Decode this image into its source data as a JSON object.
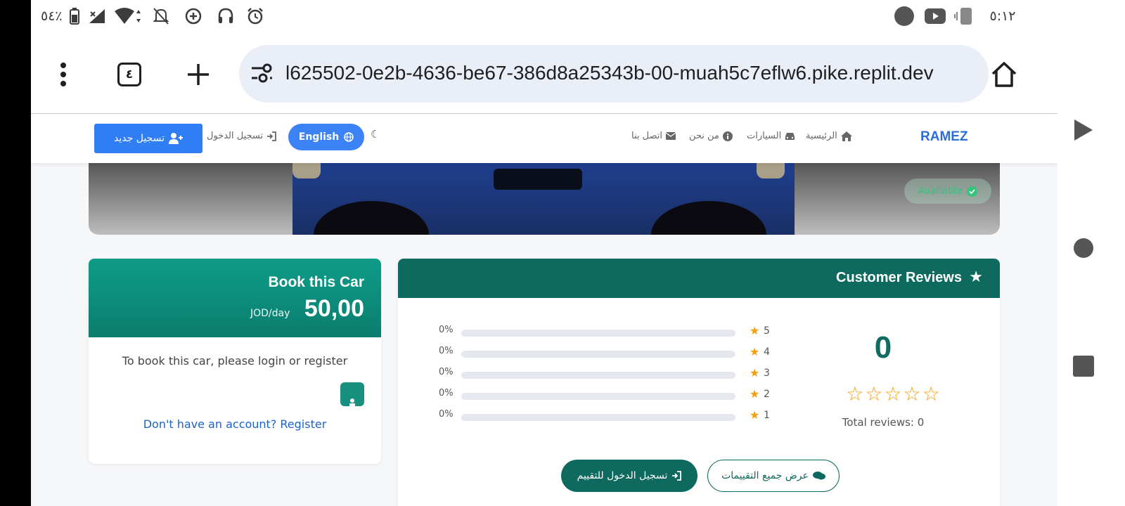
{
  "status_bar": {
    "time": "٥:١٢",
    "battery": "٥٤٪"
  },
  "browser": {
    "url": "l625502-0e2b-4636-be67-386d8a25343b-00-muah5c7eflw6.pike.replit.dev",
    "tab_count": "٤"
  },
  "site_nav": {
    "brand": "RAMEZ",
    "home": "الرئيسية",
    "cars": "السيارات",
    "about": "من نحن",
    "contact": "اتصل بنا",
    "language": "English",
    "login": "تسجيل الدخول",
    "register": "تسجيل جديد"
  },
  "hero": {
    "status": "Available"
  },
  "booking": {
    "title": "Book this Car",
    "price": "50,00",
    "unit": "JOD/day",
    "message": "To book this car, please login or register",
    "register_link": "Don't have an account? Register"
  },
  "reviews": {
    "title": "Customer Reviews",
    "average": "0",
    "total_label": "Total reviews: 0",
    "rows": [
      {
        "stars": "5",
        "percent": "0%",
        "fraction": 0
      },
      {
        "stars": "4",
        "percent": "0%",
        "fraction": 0
      },
      {
        "stars": "3",
        "percent": "0%",
        "fraction": 0
      },
      {
        "stars": "2",
        "percent": "0%",
        "fraction": 0
      },
      {
        "stars": "1",
        "percent": "0%",
        "fraction": 0
      }
    ],
    "login_to_rate": "تسجيل الدخول للتقييم",
    "view_all": "عرض جميع التقييمات"
  },
  "colors": {
    "primary_teal": "#0e6a5e",
    "accent_blue": "#2f7ef5",
    "star": "#f59e0b",
    "available": "#35c37d"
  }
}
